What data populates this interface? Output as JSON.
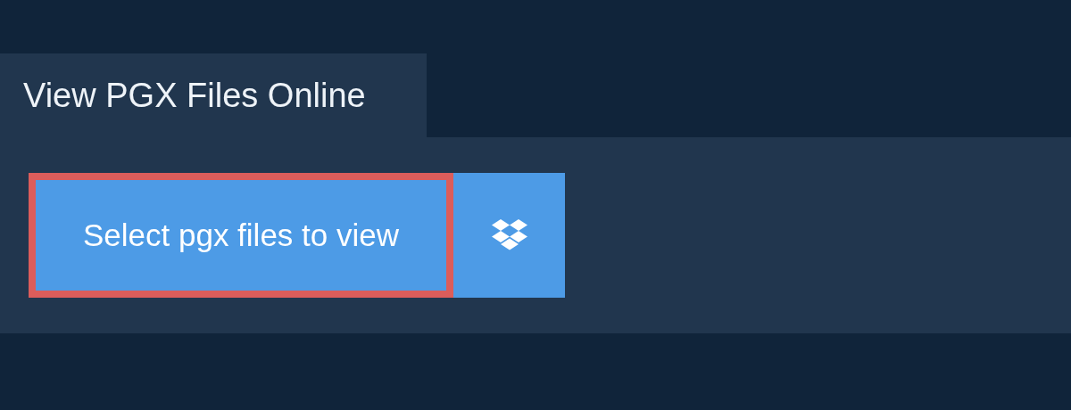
{
  "tab": {
    "label": "View PGX Files Online"
  },
  "select_button": {
    "label": "Select pgx files to view",
    "highlighted": true
  }
}
